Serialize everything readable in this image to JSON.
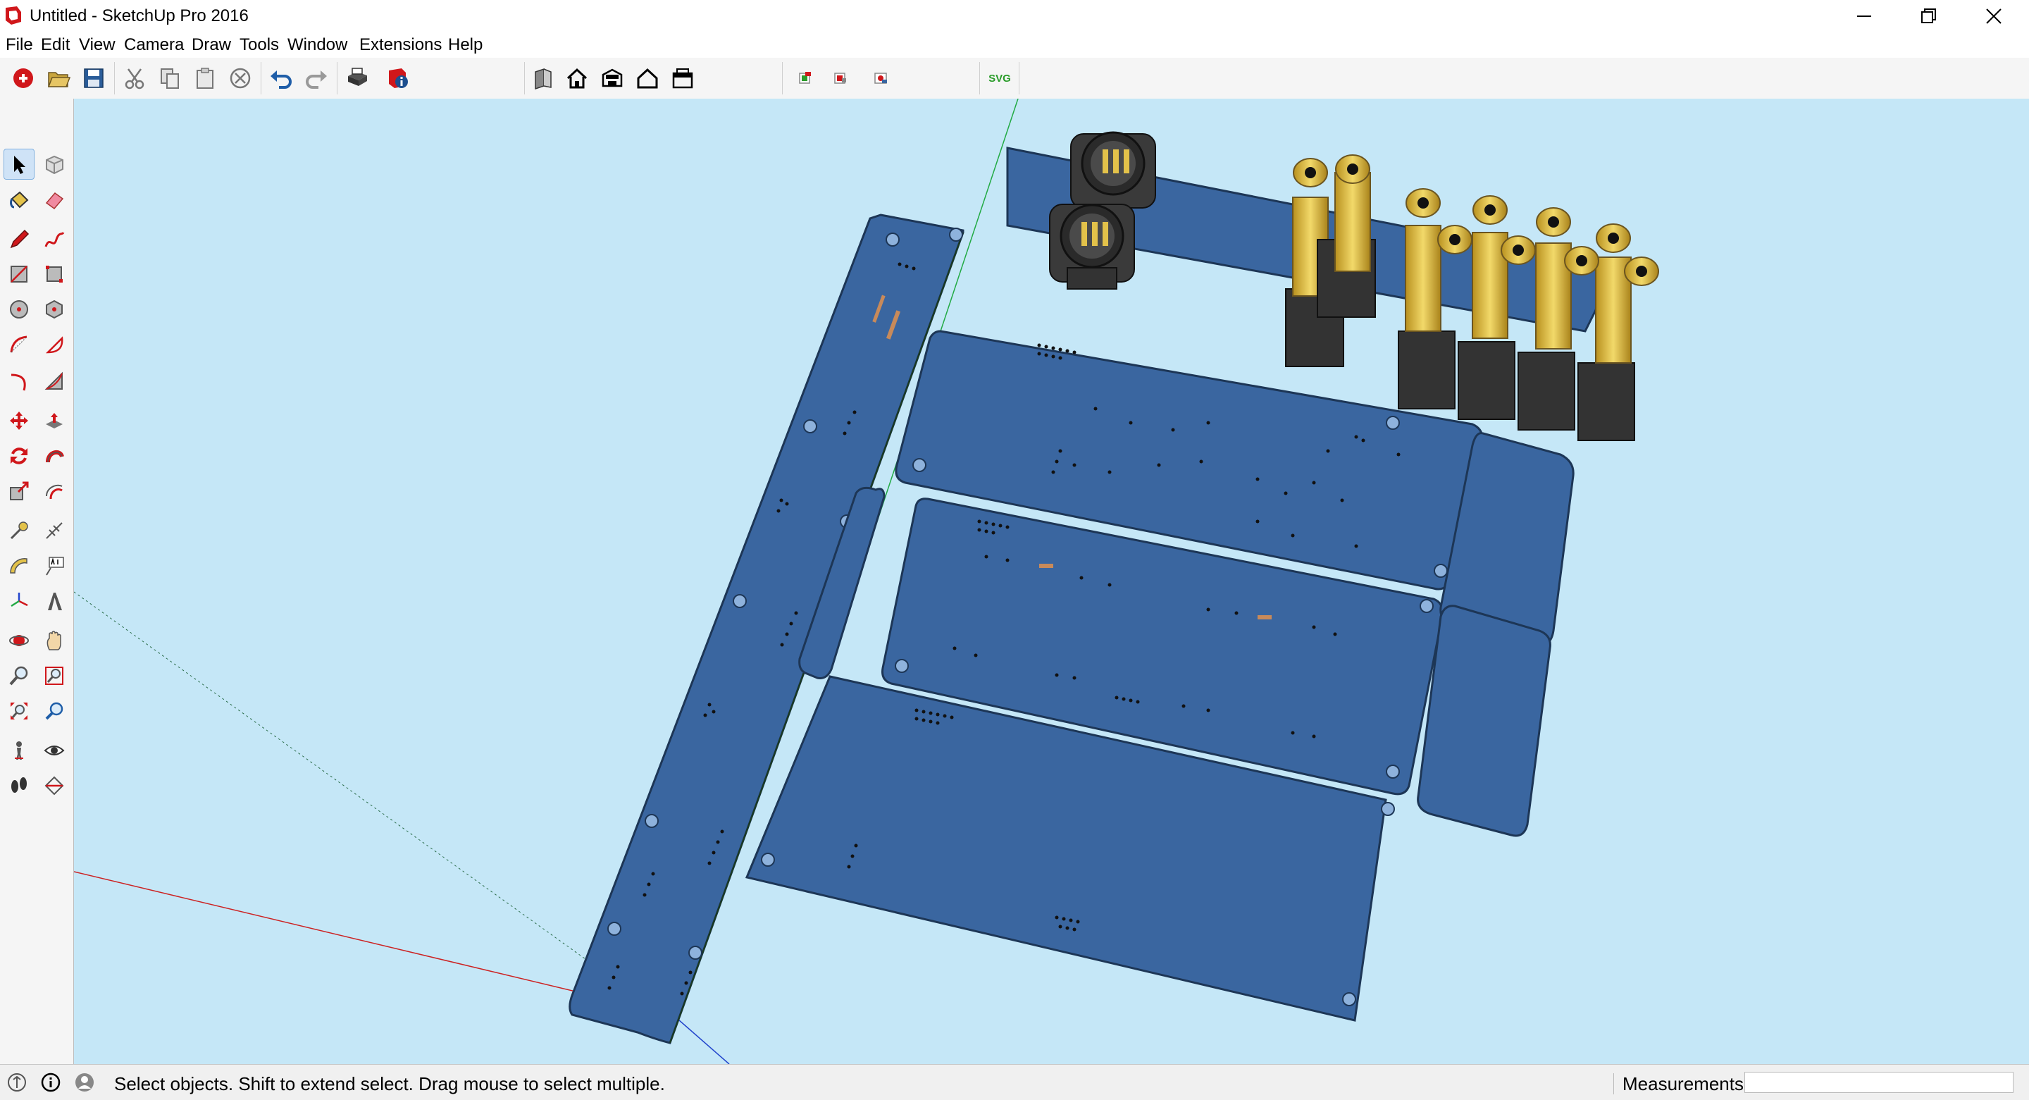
{
  "window": {
    "title": "Untitled - SketchUp Pro 2016",
    "controls": [
      "minimize-icon",
      "restore-icon",
      "close-icon"
    ]
  },
  "menu": [
    "File",
    "Edit",
    "View",
    "Camera",
    "Draw",
    "Tools",
    "Window",
    "Extensions",
    "Help"
  ],
  "toolbar": {
    "icons": [
      "new-file-icon",
      "open-folder-icon",
      "save-icon",
      "cut-icon",
      "copy-icon",
      "paste-icon",
      "erase-icon",
      "undo-icon",
      "redo-icon",
      "print-icon",
      "model-info-icon",
      "iso-view-icon",
      "home-view-icon",
      "top-view-icon",
      "front-view-icon",
      "section-view-icon",
      "import-icon",
      "export-icon",
      "extension-icon",
      "svg-export-icon"
    ],
    "svg_label": "SVG"
  },
  "left_tools": [
    "select-icon",
    "make-component-icon",
    "paint-bucket-icon",
    "eraser-icon",
    "pencil-icon",
    "freehand-icon",
    "rectangle-icon",
    "rotated-rectangle-icon",
    "circle-icon",
    "polygon-icon",
    "arc-icon",
    "pie-icon",
    "two-point-arc-icon",
    "three-point-arc-icon",
    "move-icon",
    "push-pull-icon",
    "rotate-icon",
    "follow-me-icon",
    "scale-icon",
    "offset-icon",
    "tape-measure-icon",
    "dimension-icon",
    "protractor-icon",
    "text-icon",
    "axes-icon",
    "3d-text-icon",
    "orbit-icon",
    "pan-icon",
    "zoom-icon",
    "zoom-window-icon",
    "zoom-extents-icon",
    "previous-view-icon",
    "position-camera-icon",
    "look-around-icon",
    "walk-icon",
    "section-plane-icon"
  ],
  "status": {
    "hint": "Select objects. Shift to extend select. Drag mouse to select multiple.",
    "measurements_label": "Measurements",
    "measurements_value": ""
  },
  "colors": {
    "sky": "#c5e7f7",
    "pcb_blue": "#3a66a0",
    "pcb_edge": "#1d3656",
    "gold": "#e3c24a",
    "axis_red": "#cc2222",
    "axis_green": "#22aa44",
    "axis_blue": "#2244cc"
  }
}
